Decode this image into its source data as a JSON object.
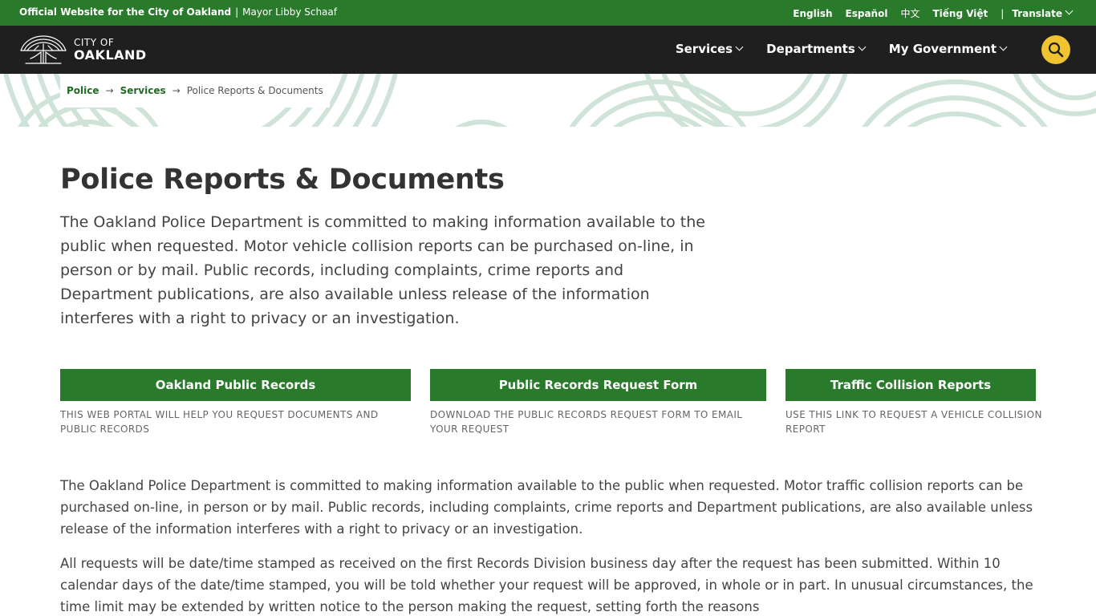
{
  "topbar": {
    "official": "Official Website for the City of Oakland",
    "separator": "|",
    "mayor": "Mayor Libby Schaaf",
    "languages": [
      "English",
      "Español",
      "中文",
      "Tiếng Việt"
    ],
    "translate_label": "Translate"
  },
  "header": {
    "logo_city": "CITY OF",
    "logo_name": "OAKLAND",
    "nav": [
      {
        "label": "Services"
      },
      {
        "label": "Departments"
      },
      {
        "label": "My Government"
      }
    ],
    "search_icon": "search-icon",
    "accent": "#f0c330"
  },
  "breadcrumb": {
    "items": [
      "Police",
      "Services"
    ],
    "arrow": "→",
    "current": "Police Reports & Documents"
  },
  "page": {
    "title": "Police Reports & Documents",
    "intro": "The Oakland Police Department is committed to making information available to the public when requested. Motor vehicle collision reports can be purchased on-line, in person or by mail. Public records, including complaints, crime reports and Department publications, are also available unless release of the information interferes with a right to privacy or an investigation."
  },
  "ctas": [
    {
      "label": "Oakland Public Records",
      "description": "THIS WEB PORTAL WILL HELP YOU REQUEST DOCUMENTS AND PUBLIC RECORDS"
    },
    {
      "label": "Public Records Request Form",
      "description": "DOWNLOAD THE PUBLIC RECORDS REQUEST FORM TO EMAIL YOUR REQUEST"
    },
    {
      "label": "Traffic Collision Reports",
      "description": "USE THIS LINK TO REQUEST A VEHICLE COLLISION REPORT"
    }
  ],
  "body": {
    "p1": "The Oakland Police Department is committed to making information available to the public when requested. Motor traffic collision reports can be purchased on-line, in person or by mail. Public records, including complaints, crime reports and Department publications, are also available unless release of the information interferes with a right to privacy or an investigation.",
    "p2": "All requests will be date/time stamped as received on the first Records Division business day after the request has been submitted. Within 10 calendar days of the date/time stamped, you will be told whether your request will be approved, in whole or in part. In unusual circumstances, the time limit may be extended by written notice to the person making the request, setting forth the reasons"
  },
  "colors": {
    "brand_green": "#2a7a2b",
    "nav_dark": "#1f1f1f",
    "pattern": "#cfe3d8"
  }
}
